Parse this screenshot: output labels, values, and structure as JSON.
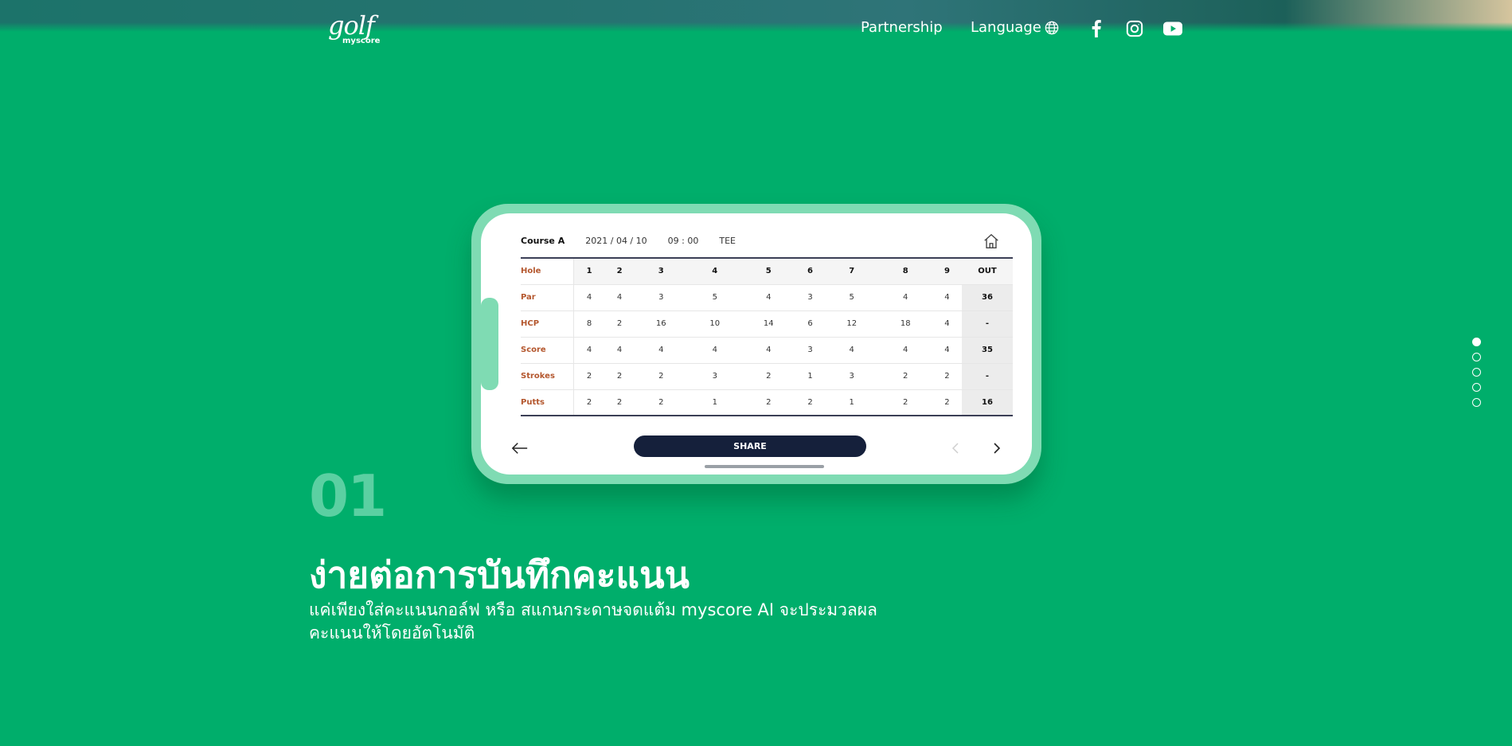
{
  "brand": {
    "logo_text": "golf",
    "logo_sub": "myscore"
  },
  "nav": {
    "partnership": "Partnership",
    "language": "Language",
    "globe_icon": "globe-icon",
    "social": [
      "facebook-icon",
      "instagram-icon",
      "youtube-icon"
    ]
  },
  "scorecard": {
    "course": "Course A",
    "date": "2021 / 04 / 10",
    "time": "09 : 00",
    "tee": "TEE",
    "holes": [
      "1",
      "2",
      "3",
      "4",
      "5",
      "6",
      "7",
      "8",
      "9"
    ],
    "out_label": "OUT",
    "rows": [
      {
        "label": "Hole",
        "values": [
          "1",
          "2",
          "3",
          "4",
          "5",
          "6",
          "7",
          "8",
          "9"
        ],
        "out": "OUT"
      },
      {
        "label": "Par",
        "values": [
          "4",
          "4",
          "3",
          "5",
          "4",
          "3",
          "5",
          "4",
          "4"
        ],
        "out": "36"
      },
      {
        "label": "HCP",
        "values": [
          "8",
          "2",
          "16",
          "10",
          "14",
          "6",
          "12",
          "18",
          "4"
        ],
        "out": "-"
      },
      {
        "label": "Score",
        "values": [
          "4",
          "4",
          "4",
          "4",
          "4",
          "3",
          "4",
          "4",
          "4"
        ],
        "out": "35"
      },
      {
        "label": "Strokes",
        "values": [
          "2",
          "2",
          "2",
          "3",
          "2",
          "1",
          "3",
          "2",
          "2"
        ],
        "out": "-"
      },
      {
        "label": "Putts",
        "values": [
          "2",
          "2",
          "2",
          "1",
          "2",
          "2",
          "1",
          "2",
          "2"
        ],
        "out": "16"
      }
    ],
    "share": "SHARE"
  },
  "hero": {
    "number": "01",
    "headline": "ง่ายต่อการบันทึกคะแนน",
    "desc_line1": "แค่เพียงใส่คะแนนกอล์ฟ หรือ สแกนกระดาษจดแต้ม myscore AI จะประมวลผล",
    "desc_line2": "คะแนนให้โดยอัตโนมัติ"
  },
  "pagination": {
    "total": 5,
    "active": 1
  },
  "colors": {
    "background": "#00ae6b",
    "accent_number": "#5bd0a2",
    "share_button": "#15203b",
    "row_label": "#b4572e"
  }
}
